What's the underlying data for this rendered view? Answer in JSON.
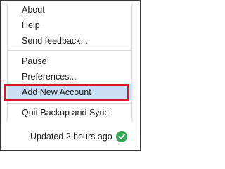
{
  "menu": {
    "items": [
      {
        "label": "About"
      },
      {
        "label": "Help"
      },
      {
        "label": "Send feedback..."
      },
      {
        "label": "Pause"
      },
      {
        "label": "Preferences..."
      },
      {
        "label": "Add New Account"
      },
      {
        "label": "Quit Backup and Sync"
      }
    ]
  },
  "status": {
    "text": "Updated 2 hours ago",
    "icon": "check-circle-icon",
    "icon_color": "#34a853"
  },
  "colors": {
    "highlight": "#c7e0f4",
    "annotation_box": "#d8182b"
  }
}
